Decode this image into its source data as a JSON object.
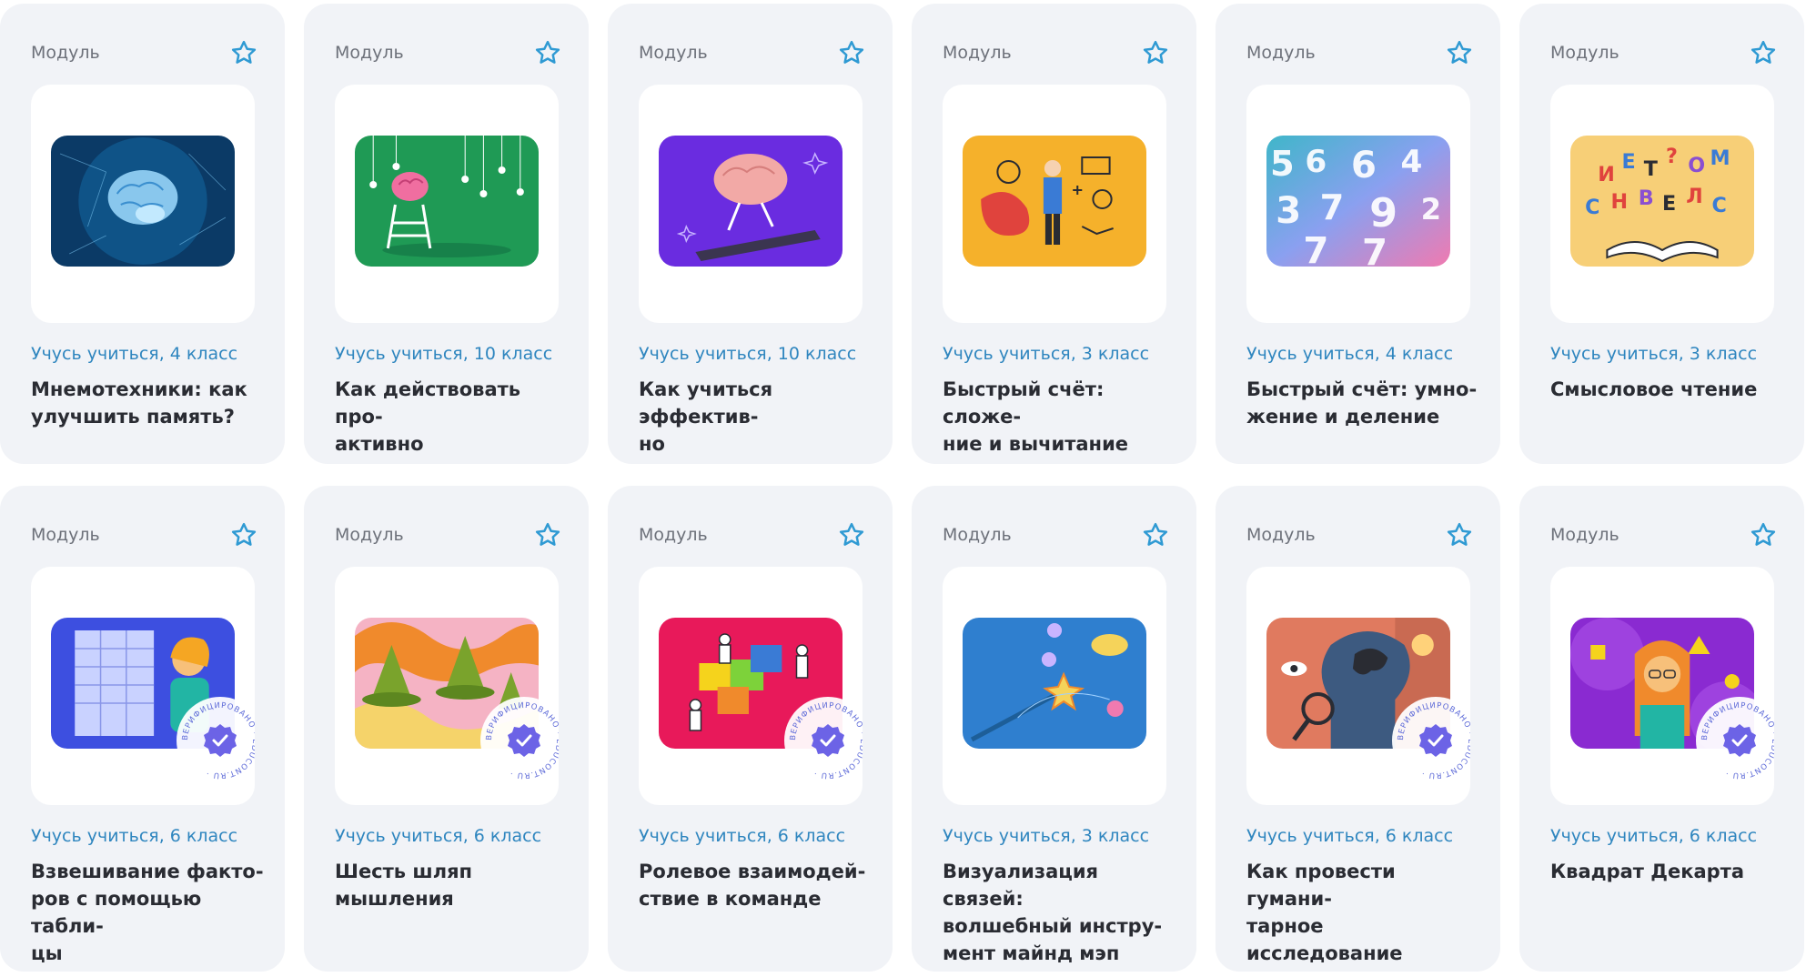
{
  "cards": [
    {
      "type_label": "Модуль",
      "meta": "Учусь учиться, 4 класс",
      "title": "Мнемотехники: как\nулучшить память?",
      "image": "brain-network-illustration",
      "verified": false
    },
    {
      "type_label": "Модуль",
      "meta": "Учусь учиться, 10 класс",
      "title": "Как действовать про-\nактивно",
      "image": "brain-on-ladder-illustration",
      "verified": false
    },
    {
      "type_label": "Модуль",
      "meta": "Учусь учиться, 10 класс",
      "title": "Как учиться эффектив-\nно",
      "image": "brain-on-treadmill-illustration",
      "verified": false
    },
    {
      "type_label": "Модуль",
      "meta": "Учусь учиться, 3 класс",
      "title": "Быстрый счёт: сложе-\nние и вычитание",
      "image": "man-with-math-doodles-illustration",
      "verified": false
    },
    {
      "type_label": "Модуль",
      "meta": "Учусь учиться, 4 класс",
      "title": "Быстрый счёт: умно-\nжение и деление",
      "image": "colorful-numbers-image",
      "verified": false
    },
    {
      "type_label": "Модуль",
      "meta": "Учусь учиться, 3 класс",
      "title": "Смысловое чтение",
      "image": "book-with-letters-illustration",
      "verified": false
    },
    {
      "type_label": "Модуль",
      "meta": "Учусь учиться, 6 класс",
      "title": "Взвешивание факто-\nров с помощью табли-\nцы",
      "image": "girl-with-table-illustration",
      "verified": true
    },
    {
      "type_label": "Модуль",
      "meta": "Учусь учиться, 6 класс",
      "title": "Шесть шляп мышления",
      "image": "hats-pattern-illustration",
      "verified": true
    },
    {
      "type_label": "Модуль",
      "meta": "Учусь учиться, 6 класс",
      "title": "Ролевое взаимодей-\nствие в команде",
      "image": "puzzle-team-illustration",
      "verified": true
    },
    {
      "type_label": "Модуль",
      "meta": "Учусь учиться, 3 класс",
      "title": "Визуализация связей:\nволшебный инстру-\nмент майнд мэп",
      "image": "magic-wand-illustration",
      "verified": false
    },
    {
      "type_label": "Модуль",
      "meta": "Учусь учиться, 6 класс",
      "title": "Как провести гумани-\nтарное исследование",
      "image": "research-head-illustration",
      "verified": true
    },
    {
      "type_label": "Модуль",
      "meta": "Учусь учиться, 6 класс",
      "title": "Квадрат Декарта",
      "image": "girl-with-shapes-illustration",
      "verified": true
    }
  ],
  "badge_text": "ВЕРИФИЦИРОВАНО · EDUCONT.RU ·",
  "colors": {
    "card_bg": "#f1f3f7",
    "meta": "#2f86bf",
    "star": "#2f9ad3",
    "title": "#2a2c33"
  }
}
